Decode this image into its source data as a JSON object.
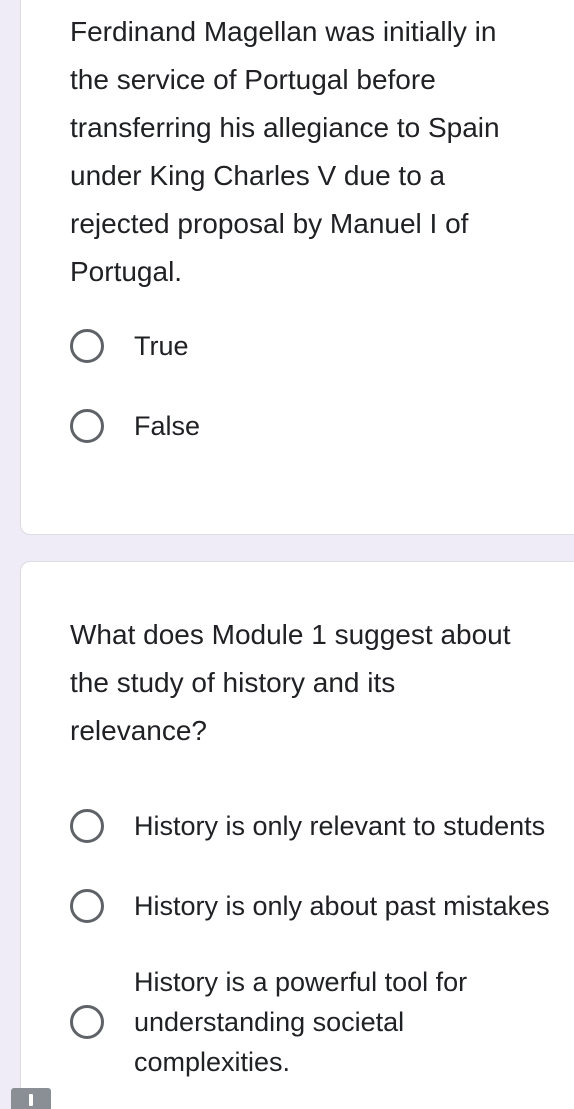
{
  "questions": [
    {
      "text": "Ferdinand Magellan was initially in\nthe service of Portugal before\ntransferring his allegiance to Spain\nunder King Charles V due to a\nrejected proposal by Manuel I of\nPortugal.",
      "options": [
        "True",
        "False"
      ]
    },
    {
      "text": "What does Module 1 suggest about\nthe study of history and its\nrelevance?",
      "options": [
        "History is only relevant to students",
        "History is only about past mistakes",
        "History is a powerful tool for\nunderstanding societal\ncomplexities."
      ]
    }
  ],
  "icons": {
    "bottom_left": "exclamation-icon"
  },
  "colors": {
    "page_background": "#efebf7",
    "card_background": "#ffffff",
    "radio_border": "#5f6368",
    "text": "#202124"
  }
}
